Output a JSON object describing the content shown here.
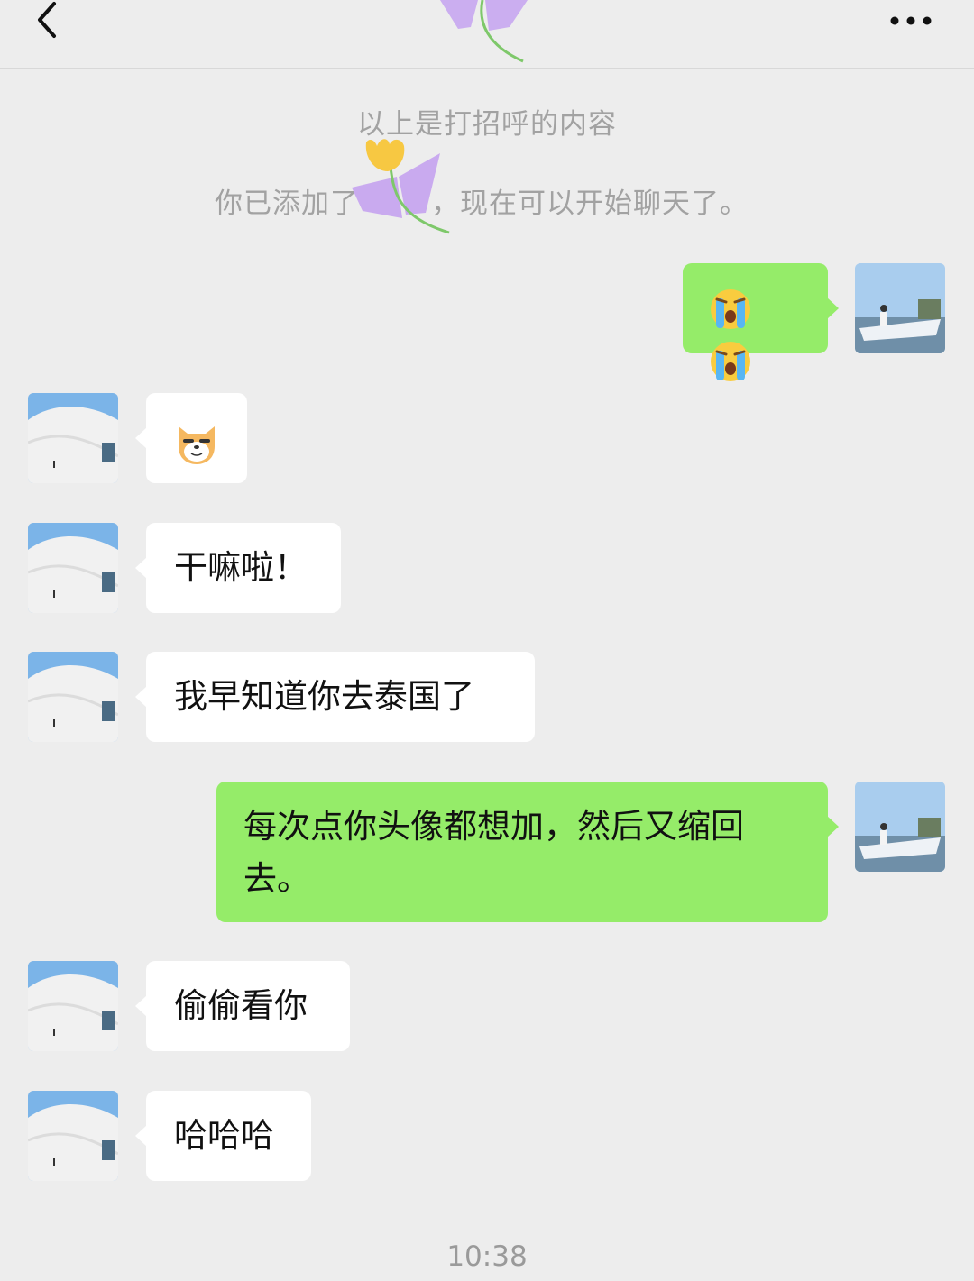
{
  "header": {
    "title": "",
    "back_icon": "chevron-left-icon",
    "more_icon": "more-dots-icon"
  },
  "system": {
    "greeting_notice": "以上是打招呼的内容",
    "added_prefix": "你已添加了",
    "added_suffix": "，现在可以开始聊天了。"
  },
  "messages": [
    {
      "side": "out",
      "type": "emoji",
      "emoji": [
        "crying-face-emoji",
        "crying-face-emoji"
      ]
    },
    {
      "side": "in",
      "type": "emoji",
      "emoji": [
        "doge-emoji"
      ]
    },
    {
      "side": "in",
      "type": "text",
      "text": "干嘛啦！"
    },
    {
      "side": "in",
      "type": "text",
      "text": "我早知道你去泰国了"
    },
    {
      "side": "out",
      "type": "text",
      "text": "每次点你头像都想加，然后又缩回去。"
    },
    {
      "side": "in",
      "type": "text",
      "text": "偷偷看你"
    },
    {
      "side": "in",
      "type": "text",
      "text": "哈哈哈"
    }
  ],
  "timestamp": "10:38",
  "colors": {
    "background": "#ededed",
    "outgoing_bubble": "#95ec69",
    "incoming_bubble": "#ffffff",
    "system_text": "#a2a2a2"
  }
}
